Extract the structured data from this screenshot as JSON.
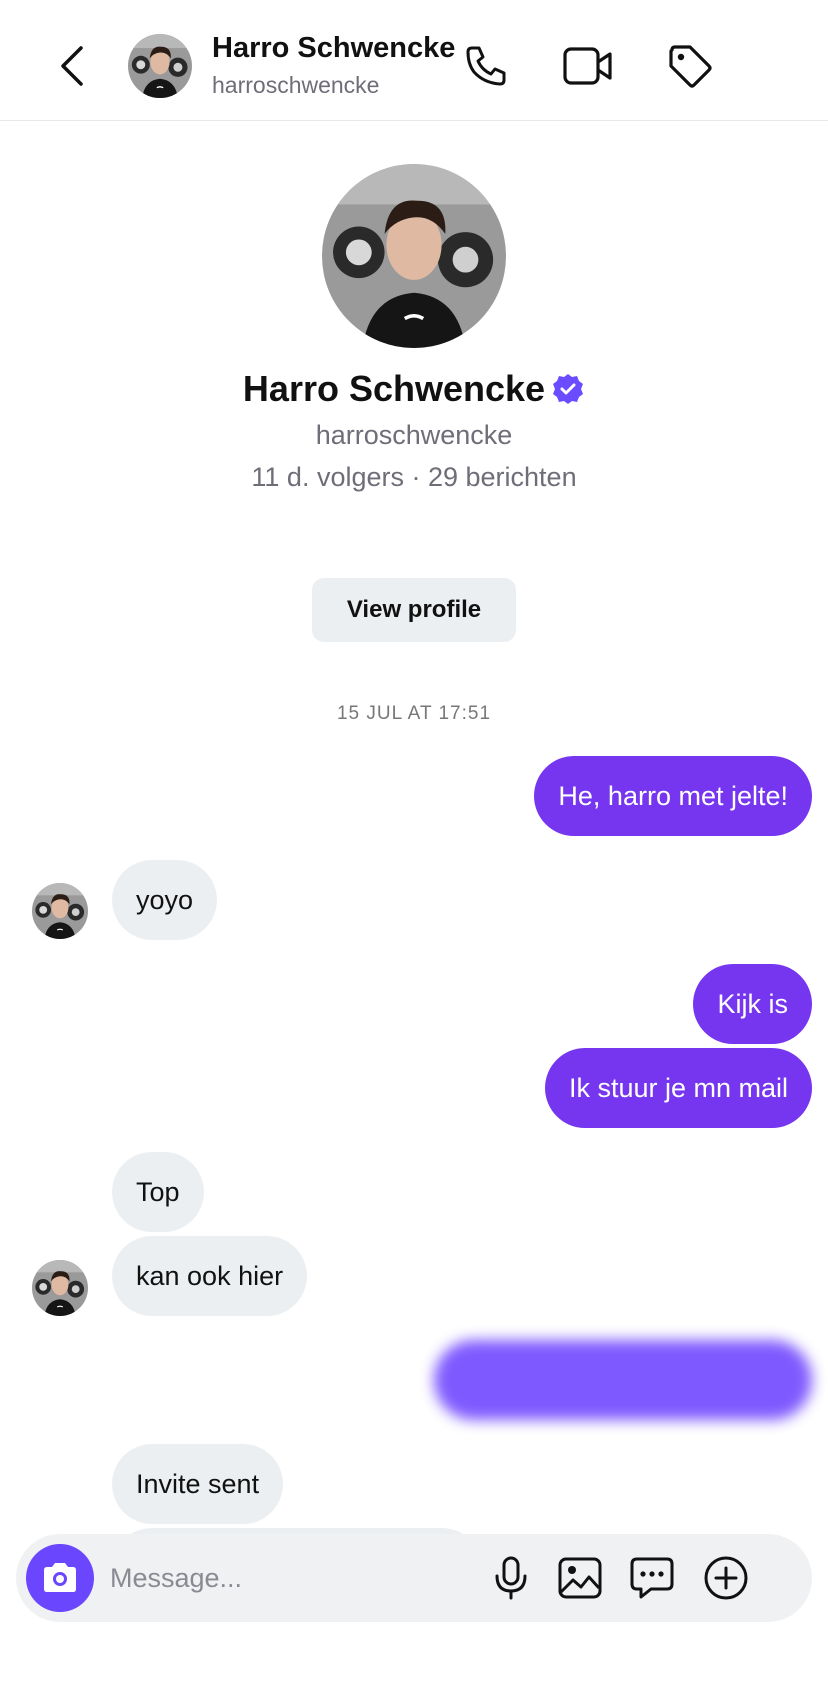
{
  "header": {
    "name": "Harro Schwencke",
    "handle": "harroschwencke"
  },
  "profile": {
    "name": "Harro Schwencke",
    "handle": "harroschwencke",
    "stats": "11 d. volgers · 29 berichten",
    "view_profile_label": "View profile"
  },
  "conversation": {
    "timestamp": "15 JUL AT 17:51",
    "messages": [
      {
        "from": "me",
        "text": "He, harro met jelte!"
      },
      {
        "from": "them",
        "text": "yoyo"
      },
      {
        "from": "me",
        "text": "Kijk is"
      },
      {
        "from": "me",
        "text": "Ik stuur je mn mail"
      },
      {
        "from": "them",
        "text": "Top"
      },
      {
        "from": "them",
        "text": "kan ook hier"
      },
      {
        "from": "me",
        "text": ""
      },
      {
        "from": "them",
        "text": "Invite sent"
      }
    ]
  },
  "composer": {
    "placeholder": "Message..."
  },
  "colors": {
    "outgoing_bubble": "#7636f0",
    "incoming_bubble": "#eceff1",
    "camera_button": "#6b46ff",
    "verified_badge": "#6b4dff"
  },
  "icons": {
    "header": [
      "chevron-left-icon",
      "phone-icon",
      "video-camera-icon",
      "tag-icon"
    ],
    "composer": [
      "camera-icon",
      "microphone-icon",
      "image-icon",
      "chat-bubble-icon",
      "plus-circle-icon"
    ]
  }
}
